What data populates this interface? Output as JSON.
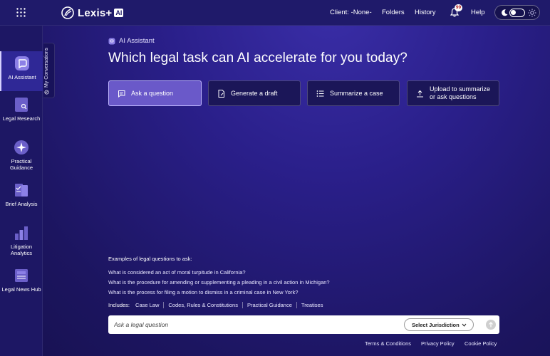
{
  "header": {
    "brand": "Lexis+",
    "brand_badge": "AI",
    "client_label": "Client: -None-",
    "folders_label": "Folders",
    "history_label": "History",
    "notification_count": "99",
    "help_label": "Help"
  },
  "sidebar": {
    "items": [
      {
        "label": "AI Assistant",
        "icon": "ai-assistant-icon"
      },
      {
        "label": "Legal Research",
        "icon": "legal-research-icon"
      },
      {
        "label": "Practical Guidance",
        "icon": "practical-guidance-icon"
      },
      {
        "label": "Brief Analysis",
        "icon": "brief-analysis-icon"
      },
      {
        "label": "Litigation Analytics",
        "icon": "litigation-analytics-icon"
      },
      {
        "label": "Legal News Hub",
        "icon": "legal-news-hub-icon"
      }
    ],
    "conversations_tab": "My Conversations"
  },
  "main": {
    "assistant_label": "AI Assistant",
    "headline": "Which legal task can AI accelerate for you today?",
    "tasks": [
      {
        "label": "Ask a question",
        "icon": "chat-icon",
        "active": true
      },
      {
        "label": "Generate a draft",
        "icon": "draft-icon",
        "active": false
      },
      {
        "label": "Summarize a case",
        "icon": "list-icon",
        "active": false
      },
      {
        "label_line1": "Upload to summarize",
        "label_line2": "or ask questions",
        "icon": "upload-icon",
        "active": false
      }
    ],
    "examples_title": "Examples of legal questions to ask:",
    "examples": [
      "What is considered an act of moral turpitude in California?",
      "What is the procedure for amending or supplementing a pleading in a civil action in Michigan?",
      "What is the process for filing a motion to dismiss in a criminal case in New York?"
    ],
    "includes_label": "Includes:",
    "sources": [
      "Case Law",
      "Codes, Rules & Constitutions",
      "Practical Guidance",
      "Treatises"
    ],
    "ask_placeholder": "Ask a legal question",
    "jurisdiction_label": "Select Jurisdiction"
  },
  "footer": {
    "terms": "Terms & Conditions",
    "privacy": "Privacy Policy",
    "cookie": "Cookie Policy"
  },
  "colors": {
    "background": "#231b7a",
    "active_card": "#6a59c9",
    "card": "#1b1658"
  }
}
